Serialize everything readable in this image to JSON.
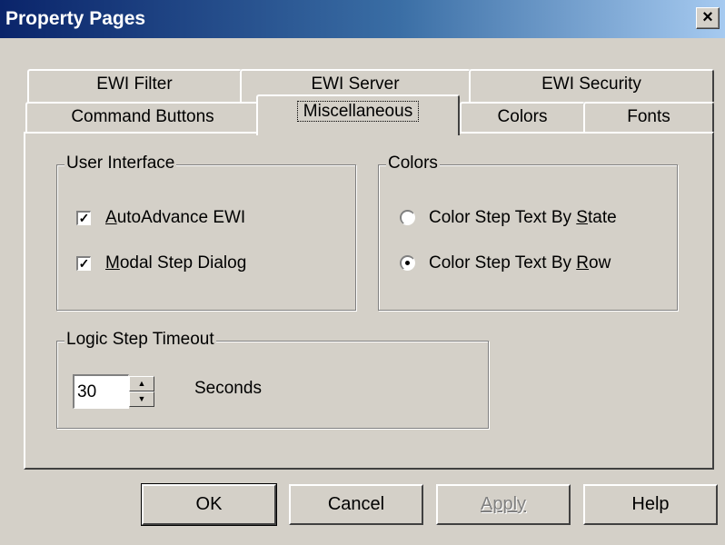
{
  "window": {
    "title": "Property Pages",
    "close_label": "×"
  },
  "tabs_back": [
    {
      "label": "EWI Filter"
    },
    {
      "label": "EWI Server"
    },
    {
      "label": "EWI Security"
    }
  ],
  "tabs_front": [
    {
      "label": "Command Buttons"
    },
    {
      "label": "Miscellaneous",
      "active": true
    },
    {
      "label": "Colors"
    },
    {
      "label": "Fonts"
    }
  ],
  "user_interface": {
    "title": "User Interface",
    "options": [
      {
        "label": "AutoAdvance EWI",
        "checked": true,
        "mnemonic": "A"
      },
      {
        "label": "Modal Step Dialog",
        "checked": true,
        "mnemonic": "M"
      }
    ]
  },
  "colors": {
    "title": "Colors",
    "options": [
      {
        "label": "Color Step Text By State",
        "selected": false,
        "mnemonic": "S"
      },
      {
        "label": "Color Step Text By Row",
        "selected": true,
        "mnemonic": "R"
      }
    ]
  },
  "logic_step_timeout": {
    "title": "Logic Step Timeout",
    "value": "30",
    "unit_label": "Seconds"
  },
  "buttons": {
    "ok": "OK",
    "cancel": "Cancel",
    "apply": "Apply",
    "help": "Help"
  },
  "theme": {
    "face": "#d4d0c8",
    "title_start": "#0a246a",
    "title_end": "#a6caf0",
    "disabled_text": "#808080"
  }
}
